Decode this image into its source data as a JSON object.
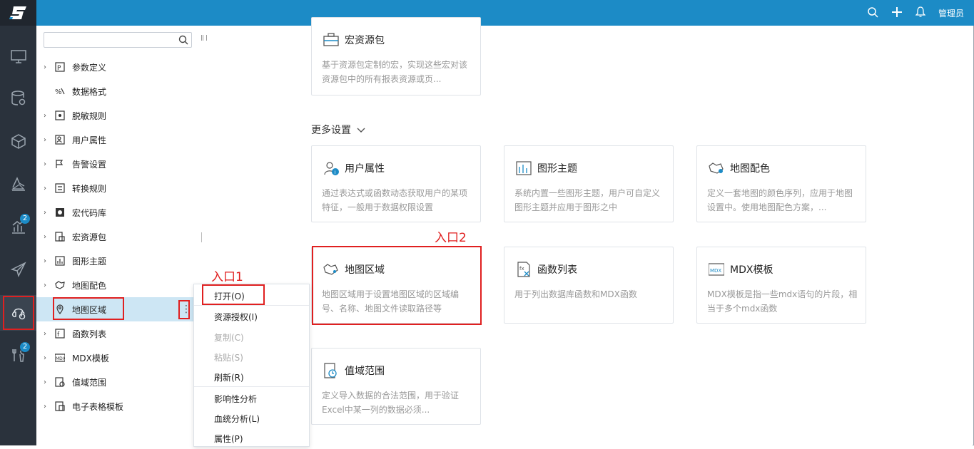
{
  "topbar": {
    "user": "管理员",
    "accent": "#1c8bc6",
    "icons": [
      "search-icon",
      "plus-icon",
      "bell-icon"
    ]
  },
  "rail": {
    "items": [
      {
        "icon": "monitor-icon"
      },
      {
        "icon": "database-icon"
      },
      {
        "icon": "cube-icon"
      },
      {
        "icon": "analysis-icon"
      },
      {
        "icon": "chart-icon",
        "badge": "2"
      },
      {
        "icon": "send-icon"
      },
      {
        "icon": "resource-icon",
        "active": true
      },
      {
        "icon": "tools-icon",
        "badge": "2"
      }
    ]
  },
  "tree": {
    "search_placeholder": "",
    "items": [
      {
        "label": "参数定义",
        "icon": "param-icon",
        "expandable": true
      },
      {
        "label": "数据格式",
        "icon": "format-icon",
        "expandable": false
      },
      {
        "label": "脱敏规则",
        "icon": "mask-icon",
        "expandable": true
      },
      {
        "label": "用户属性",
        "icon": "user-attr-icon",
        "expandable": true
      },
      {
        "label": "告警设置",
        "icon": "alert-icon",
        "expandable": true
      },
      {
        "label": "转换规则",
        "icon": "convert-icon",
        "expandable": true
      },
      {
        "label": "宏代码库",
        "icon": "macro-code-icon",
        "expandable": true
      },
      {
        "label": "宏资源包",
        "icon": "macro-package-icon",
        "expandable": true
      },
      {
        "label": "图形主题",
        "icon": "graph-theme-icon",
        "expandable": true
      },
      {
        "label": "地图配色",
        "icon": "map-color-icon",
        "expandable": true
      },
      {
        "label": "地图区域",
        "icon": "map-pin-icon",
        "expandable": false,
        "selected": true
      },
      {
        "label": "函数列表",
        "icon": "function-icon",
        "expandable": true
      },
      {
        "label": "MDX模板",
        "icon": "mdx-icon",
        "expandable": true
      },
      {
        "label": "值域范围",
        "icon": "range-icon",
        "expandable": true
      },
      {
        "label": "电子表格模板",
        "icon": "spreadsheet-icon",
        "expandable": true
      }
    ]
  },
  "context_menu": {
    "items": [
      {
        "label": "打开(O)",
        "disabled": false
      },
      {
        "label": "资源授权(I)",
        "disabled": false
      },
      {
        "label": "复制(C)",
        "disabled": true
      },
      {
        "label": "粘贴(S)",
        "disabled": true
      },
      {
        "label": "刷新(R)",
        "disabled": false
      },
      {
        "label": "影响性分析",
        "disabled": false
      },
      {
        "label": "血统分析(L)",
        "disabled": false
      },
      {
        "label": "属性(P)",
        "disabled": false
      }
    ]
  },
  "annotations": {
    "entry1": "入口1",
    "entry2": "入口2",
    "color": "#e02020"
  },
  "main": {
    "top_card": {
      "title": "宏资源包",
      "desc": "基于资源包定制的宏，实现这些宏对该资源包中的所有报表资源或页..."
    },
    "section_title": "更多设置",
    "cards": [
      {
        "title": "用户属性",
        "icon": "user-attr-icon",
        "desc": "通过表达式或函数动态获取用户的某项特征，一般用于数据权限设置"
      },
      {
        "title": "图形主题",
        "icon": "graph-theme-icon",
        "desc": "系统内置一些图形主题，用户可自定义图形主题并应用于图形之中"
      },
      {
        "title": "地图配色",
        "icon": "map-color-icon",
        "desc": "定义一套地图的颜色序列，应用于地图设置中。使用地图配色方案，..."
      },
      {
        "title": "地图区域",
        "icon": "map-region-icon",
        "desc": "地图区域用于设置地图区域的区域编号、名称、地图文件读取路径等"
      },
      {
        "title": "函数列表",
        "icon": "function-icon",
        "desc": "用于列出数据库函数和MDX函数"
      },
      {
        "title": "MDX模板",
        "icon": "mdx-icon",
        "desc": "MDX模板是指一些mdx语句的片段，相当于多个mdx函数"
      },
      {
        "title": "值域范围",
        "icon": "range-icon",
        "desc": "定义导入数据的合法范围，用于验证Excel中某一列的数据必须..."
      }
    ]
  }
}
